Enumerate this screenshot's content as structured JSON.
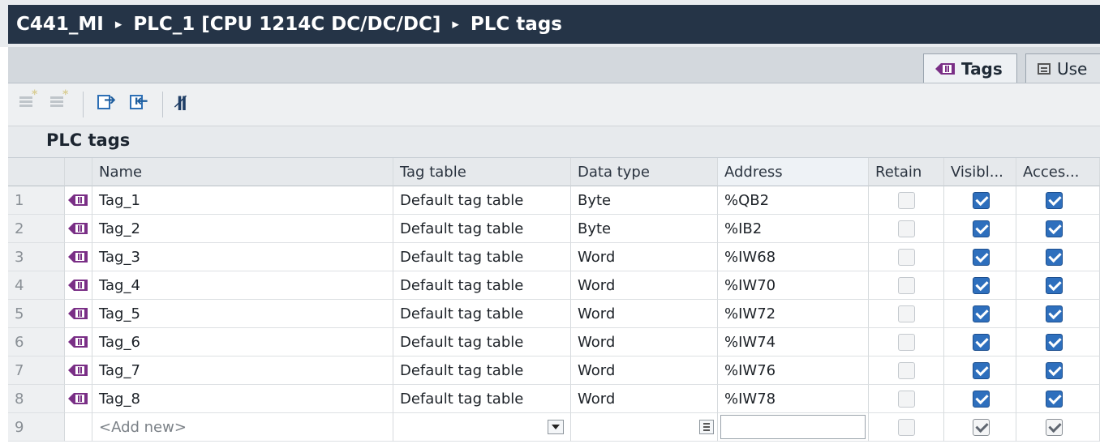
{
  "breadcrumb": {
    "project": "C441_MI",
    "device": "PLC_1 [CPU 1214C DC/DC/DC]",
    "page": "PLC tags",
    "separator": "▸"
  },
  "tabs": [
    {
      "label": "Tags",
      "icon": "tag-icon",
      "active": true
    },
    {
      "label": "Use",
      "icon": "list-icon",
      "active": false
    }
  ],
  "toolbar": {
    "buttons": [
      {
        "icon": "insert-row-icon",
        "enabled": false
      },
      {
        "icon": "add-row-icon",
        "enabled": false
      },
      {
        "icon": "export-icon",
        "enabled": true
      },
      {
        "icon": "import-icon",
        "enabled": true
      },
      {
        "icon": "show-hide-columns-icon",
        "enabled": true
      }
    ]
  },
  "section_title": "PLC tags",
  "columns": {
    "name": "Name",
    "tag_table": "Tag table",
    "data_type": "Data type",
    "address": "Address",
    "retain": "Retain",
    "visible": "Visibl...",
    "accessible": "Acces..."
  },
  "rows": [
    {
      "num": "1",
      "name": "Tag_1",
      "tag_table": "Default tag table",
      "data_type": "Byte",
      "address": "%QB2",
      "retain": false,
      "visible": true,
      "accessible": true
    },
    {
      "num": "2",
      "name": "Tag_2",
      "tag_table": "Default tag table",
      "data_type": "Byte",
      "address": "%IB2",
      "retain": false,
      "visible": true,
      "accessible": true
    },
    {
      "num": "3",
      "name": "Tag_3",
      "tag_table": "Default tag table",
      "data_type": "Word",
      "address": "%IW68",
      "retain": false,
      "visible": true,
      "accessible": true
    },
    {
      "num": "4",
      "name": "Tag_4",
      "tag_table": "Default tag table",
      "data_type": "Word",
      "address": "%IW70",
      "retain": false,
      "visible": true,
      "accessible": true
    },
    {
      "num": "5",
      "name": "Tag_5",
      "tag_table": "Default tag table",
      "data_type": "Word",
      "address": "%IW72",
      "retain": false,
      "visible": true,
      "accessible": true
    },
    {
      "num": "6",
      "name": "Tag_6",
      "tag_table": "Default tag table",
      "data_type": "Word",
      "address": "%IW74",
      "retain": false,
      "visible": true,
      "accessible": true
    },
    {
      "num": "7",
      "name": "Tag_7",
      "tag_table": "Default tag table",
      "data_type": "Word",
      "address": "%IW76",
      "retain": false,
      "visible": true,
      "accessible": true
    },
    {
      "num": "8",
      "name": "Tag_8",
      "tag_table": "Default tag table",
      "data_type": "Word",
      "address": "%IW78",
      "retain": false,
      "visible": true,
      "accessible": true
    }
  ],
  "new_row": {
    "num": "9",
    "name": "<Add new>",
    "retain": false,
    "visible": true,
    "accessible": true
  },
  "colors": {
    "title_bar": "#253447",
    "tag_icon": "#7a2f86",
    "checkbox_checked": "#2e6fbd"
  }
}
